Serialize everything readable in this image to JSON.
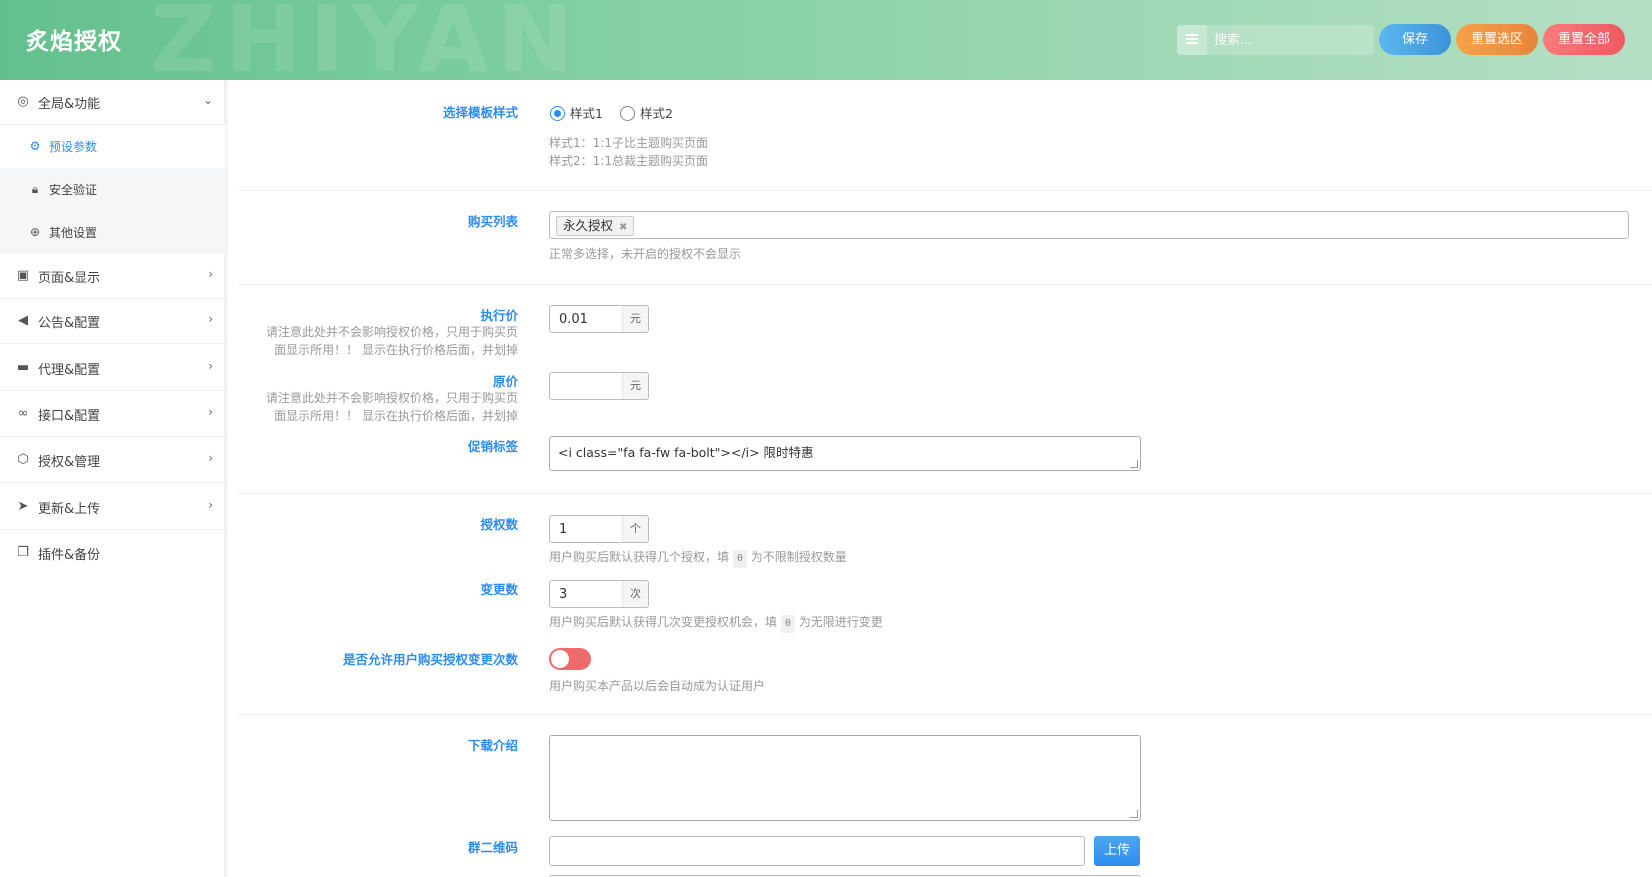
{
  "header": {
    "brand": "炙焰授权",
    "watermark": "ZHIYAN",
    "search_placeholder": "搜索...",
    "save_label": "保存",
    "reset_selection_label": "重置选区",
    "reset_all_label": "重置全部"
  },
  "sidebar": {
    "items": [
      {
        "label": "全局&功能",
        "icon": "target-icon",
        "chevron": "⌄"
      },
      {
        "label": "页面&显示",
        "icon": "calendar-icon",
        "chevron": "›"
      },
      {
        "label": "公告&配置",
        "icon": "bullhorn-icon",
        "chevron": "›"
      },
      {
        "label": "代理&配置",
        "icon": "credit-card-icon",
        "chevron": "›"
      },
      {
        "label": "接口&配置",
        "icon": "link-icon",
        "chevron": "›"
      },
      {
        "label": "授权&管理",
        "icon": "gem-icon",
        "chevron": "›"
      },
      {
        "label": "更新&上传",
        "icon": "paper-plane-icon",
        "chevron": "›"
      },
      {
        "label": "插件&备份",
        "icon": "copy-icon",
        "chevron": ""
      }
    ],
    "subitems": [
      {
        "label": "预设参数",
        "icon": "gears-icon",
        "active": true
      },
      {
        "label": "安全验证",
        "icon": "lock-icon",
        "active": false
      },
      {
        "label": "其他设置",
        "icon": "lifebuoy-icon",
        "active": false
      }
    ]
  },
  "form": {
    "template_style": {
      "label": "选择模板样式",
      "options": [
        "样式1",
        "样式2"
      ],
      "selected": "样式1",
      "help_1": "样式1：1:1子比主题购买页面",
      "help_2": "样式2：1:1总裁主题购买页面"
    },
    "purchase_list": {
      "label": "购买列表",
      "tags": [
        "永久授权"
      ],
      "tag_remove": "✖",
      "help": "正常多选择，未开启的授权不会显示"
    },
    "exec_price": {
      "label": "执行价",
      "desc_1": "请注意此处并不会影响授权价格，只用于购买页",
      "desc_2": "面显示所用！！ 显示在执行价格后面，并划掉",
      "value": "0.01",
      "unit": "元"
    },
    "original_price": {
      "label": "原价",
      "desc_1": "请注意此处并不会影响授权价格，只用于购买页",
      "desc_2": "面显示所用！！ 显示在执行价格后面，并划掉",
      "value": "",
      "unit": "元"
    },
    "promo_tag": {
      "label": "促销标签",
      "value": "<i class=\"fa fa-fw fa-bolt\"></i> 限时特惠"
    },
    "auth_count": {
      "label": "授权数",
      "value": "1",
      "unit": "个",
      "help_before": "用户购买后默认获得几个授权，填",
      "help_code": "0",
      "help_after": "为不限制授权数量"
    },
    "change_count": {
      "label": "变更数",
      "value": "3",
      "unit": "次",
      "help_before": "用户购买后默认获得几次变更授权机会，填",
      "help_code": "0",
      "help_after": "为无限进行变更"
    },
    "allow_buy_changes": {
      "label": "是否允许用户购买授权变更次数",
      "enabled": false,
      "help": "用户购买本产品以后会自动成为认证用户"
    },
    "download_intro": {
      "label": "下载介绍",
      "value": ""
    },
    "group_qrcode": {
      "label": "群二维码",
      "value": "",
      "upload_label": "上传"
    }
  }
}
